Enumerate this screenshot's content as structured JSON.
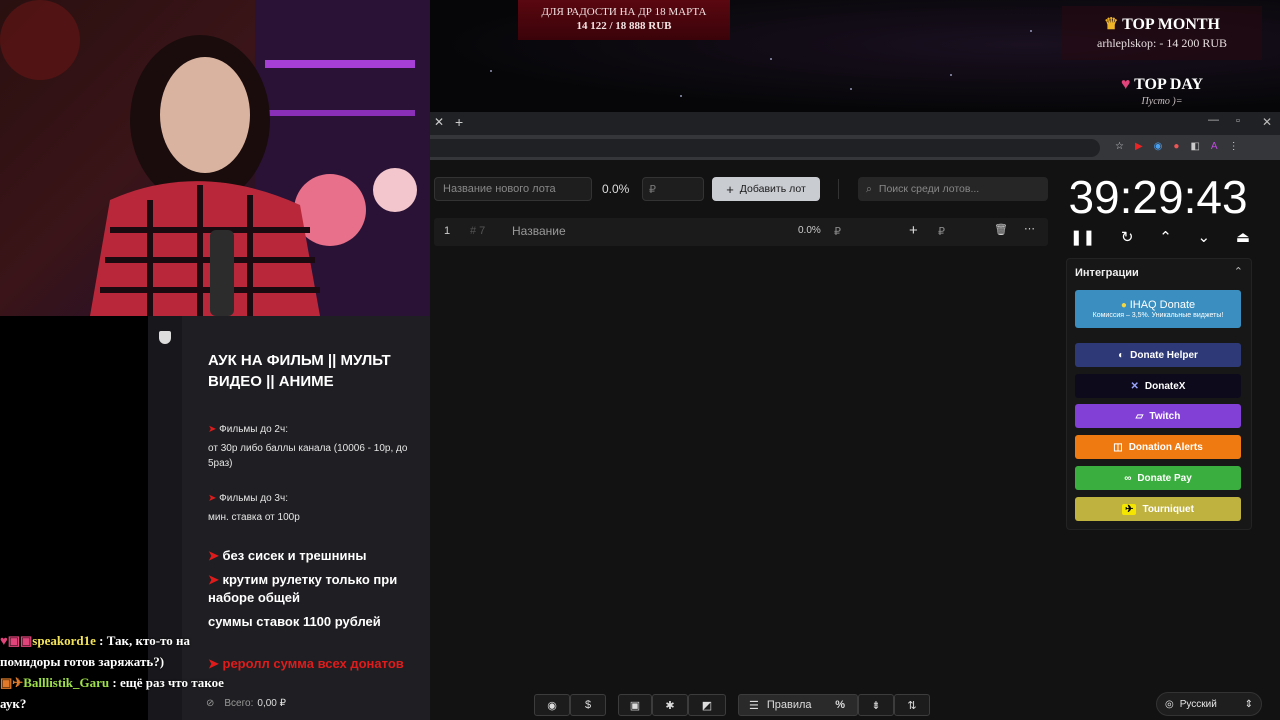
{
  "overlay": {
    "goal_title": "ДЛЯ РАДОСТИ НА ДР 18 МАРТА",
    "goal_amount": "14 122 / 18 888 RUB",
    "top_month_title": "TOP MONTH",
    "top_month_value": "arhleplskop: - 14 200 RUB",
    "top_day_title": "TOP DAY",
    "top_day_value": "Пусто )="
  },
  "panel": {
    "heading": "АУК НА ФИЛЬМ || МУЛЬТ ВИДЕО || АНИМЕ",
    "rule1_title": "Фильмы до 2ч:",
    "rule1_text": "от 30р либо баллы канала (10006 - 10р, до 5раз)",
    "rule2_title": "Фильмы до 3ч:",
    "rule2_text": "мин. ставка от 100р",
    "rule3": "без сисек и трешнины",
    "rule4": "крутим рулетку только при наборе общей",
    "rule5": "суммы ставок 1100 рублей",
    "rule6": "реролл сумма всех донатов",
    "total_label": "Всего:",
    "total_value": "0,00 ₽"
  },
  "chat": [
    {
      "user": "speakord1e",
      "text": "Так, кто-то на помидоры готов заряжать?)"
    },
    {
      "user": "Balllistik_Garu",
      "text": "ещё раз что такое аук?"
    }
  ],
  "app": {
    "lot_placeholder": "Название нового лота",
    "percent": "0.0%",
    "currency_placeholder": "₽",
    "add_button": "Добавить лот",
    "search_placeholder": "Поиск среди лотов...",
    "row": {
      "index": "1",
      "id": "# 7",
      "name": "Название",
      "percent": "0.0%",
      "currency": "₽",
      "amount_currency": "₽"
    },
    "timer": "39:29:43",
    "integrations_title": "Интеграции",
    "integrations": [
      {
        "label": "IHAQ Donate",
        "sub": "Комиссия – 3,5%. Уникальные виджеты!",
        "color": "#3a8fc0"
      },
      {
        "label": "Donate Helper",
        "color": "#2e3a78"
      },
      {
        "label": "DonateX",
        "color": "#0d0a1c"
      },
      {
        "label": "Twitch",
        "color": "#8240d6"
      },
      {
        "label": "Donation Alerts",
        "color": "#f07a12"
      },
      {
        "label": "Donate Pay",
        "color": "#3aae3e"
      },
      {
        "label": "Tourniquet",
        "color": "#bfb23e"
      }
    ],
    "bottom": {
      "rules": "Правила",
      "percent_icon": "%",
      "language": "Русский"
    }
  }
}
